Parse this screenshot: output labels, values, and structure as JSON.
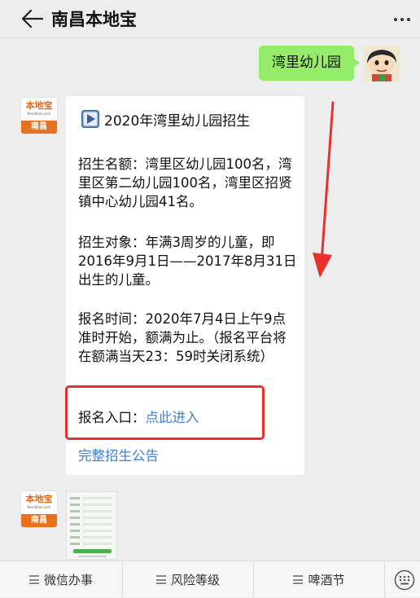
{
  "header": {
    "title": "南昌本地宝"
  },
  "messages": {
    "sent_text": "湾里幼儿园"
  },
  "oa_avatar": {
    "logo_text": "本地宝",
    "logo_sub": "Bendibao.com",
    "city": "南昌"
  },
  "card": {
    "title": "2020年湾里幼儿园招生",
    "para1": "招生名额：湾里区幼儿园100名，湾里区第二幼儿园100名，湾里区招贤镇中心幼儿园41名。",
    "para2": "招生对象：年满3周岁的儿童，即2016年9月1日——2017年8月31日出生的儿童。",
    "para3": "报名时间：2020年7月4日上午9点准时开始，额满为止。（报名平台将在额满当天23：59时关闭系统）",
    "entry_label": "报名入口：",
    "entry_link": "点此进入",
    "full_notice_link": "完整招生公告"
  },
  "menu": {
    "items": [
      "微信办事",
      "风险等级",
      "啤酒节"
    ]
  },
  "colors": {
    "bubble_green": "#95ec69",
    "link_blue": "#3e7fd3",
    "highlight_red": "#e8302d",
    "brand_orange": "#e8711e"
  },
  "icons": [
    "back-arrow-icon",
    "more-dots-icon",
    "play-icon",
    "menu-list-icon",
    "keyboard-icon"
  ]
}
